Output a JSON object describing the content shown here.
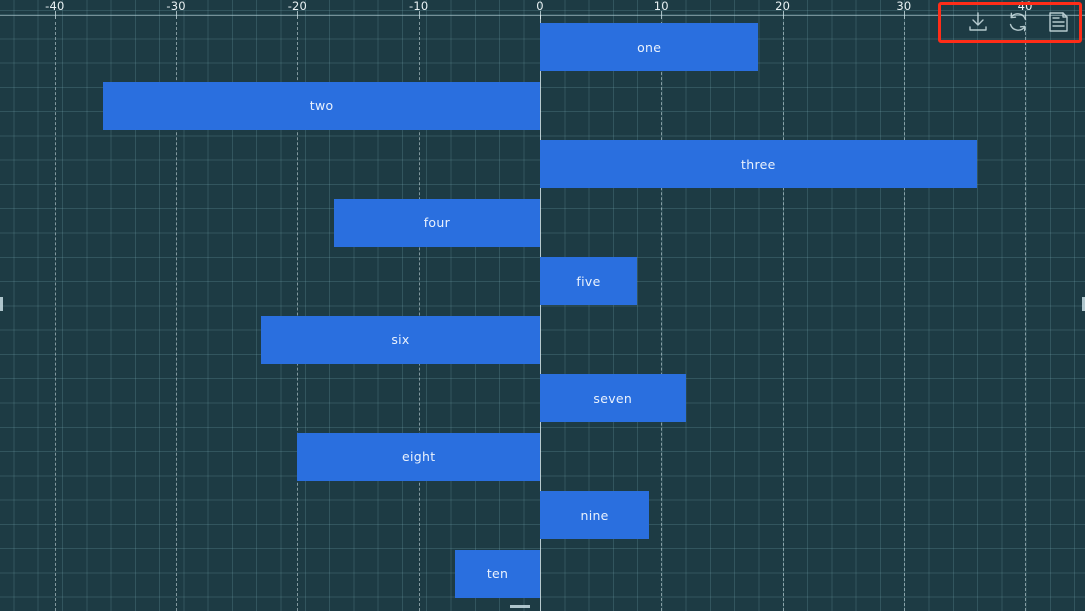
{
  "chart_data": {
    "type": "bar",
    "orientation": "horizontal",
    "title": "",
    "xlabel": "",
    "ylabel": "",
    "xlim": [
      -44.5,
      44.9
    ],
    "grid": true,
    "legend": "none",
    "axis_position": "top",
    "xticks": [
      -40,
      -30,
      -20,
      -10,
      0,
      10,
      20,
      30,
      40
    ],
    "xtick_labels": [
      "-40",
      "-30",
      "-20",
      "-10",
      "0",
      "10",
      "20",
      "30",
      "40"
    ],
    "categories": [
      "one",
      "two",
      "three",
      "four",
      "five",
      "six",
      "seven",
      "eight",
      "nine",
      "ten"
    ],
    "values": [
      18,
      -36,
      36,
      -17,
      8,
      -23,
      12,
      -20,
      9,
      -7
    ],
    "bar_color": "#2a6fdf",
    "label_color": "#eaf2fd",
    "background_color": "#1d3b44",
    "gridline_color": "#7db2ba"
  },
  "toolbar": {
    "buttons": [
      {
        "name": "download-icon",
        "label": "Download"
      },
      {
        "name": "reset-icon",
        "label": "Reset"
      },
      {
        "name": "menu-icon",
        "label": "Menu"
      }
    ],
    "highlight_color": "#ff2d18"
  }
}
